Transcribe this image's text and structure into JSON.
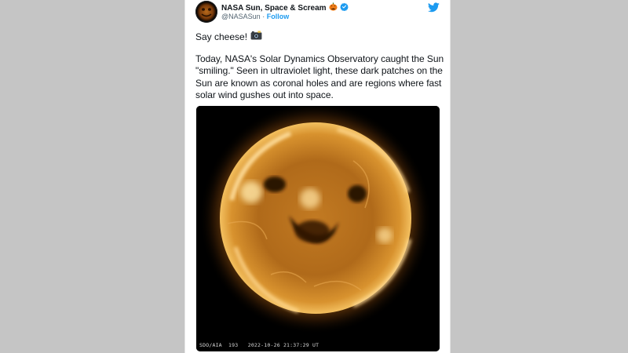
{
  "account": {
    "display_name": "NASA Sun, Space & Scream",
    "handle": "@NASASun",
    "separator": "·",
    "follow_label": "Follow"
  },
  "tweet": {
    "line1": "Say cheese!",
    "body": "Today, NASA's Solar Dynamics Observatory caught the Sun \"smiling.\" Seen in ultraviolet light, these dark patches on the Sun are known as coronal holes and are regions where fast solar wind gushes out into space."
  },
  "media": {
    "caption": "SDO/AIA  193   2022-10-26 21:37:29 UT"
  },
  "icons": {
    "avatar": "sun-avatar",
    "emoji_name": "jack-o-lantern-icon",
    "verified": "verified-badge-icon",
    "brand": "twitter-bird-icon",
    "camera": "camera-flash-icon"
  },
  "colors": {
    "background": "#c5c5c5",
    "link": "#1d9bf0",
    "text": "#0f1419",
    "muted": "#536471"
  }
}
